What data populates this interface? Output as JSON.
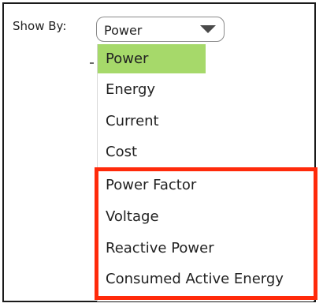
{
  "form": {
    "show_by_label": "Show By:",
    "select_value": "Power"
  },
  "menu": {
    "items": [
      {
        "label": "Power",
        "selected": true
      },
      {
        "label": "Energy"
      },
      {
        "label": "Current"
      },
      {
        "label": "Cost"
      },
      {
        "label": "Power Factor"
      },
      {
        "label": "Voltage"
      },
      {
        "label": "Reactive Power"
      },
      {
        "label": "Consumed Active Energy"
      }
    ]
  },
  "colors": {
    "selected_background": "#a6d96a",
    "highlight_border": "#ff2a0a"
  },
  "icons": {
    "dropdown": "chevron-down-icon"
  }
}
